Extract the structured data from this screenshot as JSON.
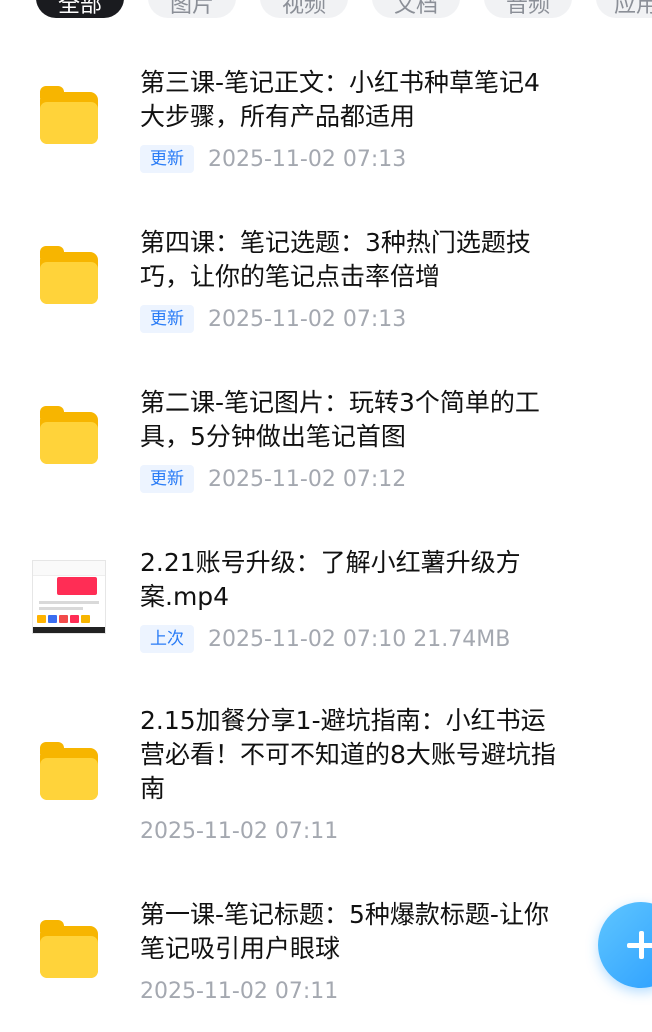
{
  "filters": [
    {
      "label": "全部",
      "active": true
    },
    {
      "label": "图片",
      "active": false
    },
    {
      "label": "视频",
      "active": false
    },
    {
      "label": "文档",
      "active": false
    },
    {
      "label": "音频",
      "active": false
    },
    {
      "label": "应用",
      "active": false
    }
  ],
  "items": [
    {
      "type": "folder",
      "icon": "folder-icon",
      "title_line1": "第三课-笔记正文：小红书种草笔记4",
      "title_line2": "大步骤，所有产品都适用",
      "title_line3": "",
      "badge": "更新",
      "meta": "2025-11-02  07:13"
    },
    {
      "type": "folder",
      "icon": "folder-icon",
      "title_line1": "第四课：笔记选题：3种热门选题技",
      "title_line2": "巧，让你的笔记点击率倍增",
      "title_line3": "",
      "badge": "更新",
      "meta": "2025-11-02  07:13"
    },
    {
      "type": "folder",
      "icon": "folder-icon",
      "title_line1": "第二课-笔记图片：玩转3个简单的工",
      "title_line2": "具，5分钟做出笔记首图",
      "title_line3": "",
      "badge": "更新",
      "meta": "2025-11-02  07:12"
    },
    {
      "type": "video",
      "icon": "video-thumbnail",
      "title_line1": "2.21账号升级：了解小红薯升级方",
      "title_line2": "案.mp4",
      "title_line3": "",
      "badge": "上次",
      "meta": "2025-11-02  07:10  21.74MB"
    },
    {
      "type": "folder",
      "icon": "folder-icon",
      "title_line1": "2.15加餐分享1-避坑指南：小红书运",
      "title_line2": "营必看！不可不知道的8大账号避坑指",
      "title_line3": "南",
      "badge": "",
      "meta": "2025-11-02  07:11"
    },
    {
      "type": "folder",
      "icon": "folder-icon",
      "title_line1": "第一课-笔记标题：5种爆款标题-让你",
      "title_line2": "笔记吸引用户眼球",
      "title_line3": "",
      "badge": "",
      "meta": "2025-11-02  07:11"
    }
  ],
  "fab": {
    "icon": "plus-icon"
  },
  "colors": {
    "accent": "#2a7cf6",
    "folder": "#ffd33a",
    "fab": "#2a9dff"
  }
}
